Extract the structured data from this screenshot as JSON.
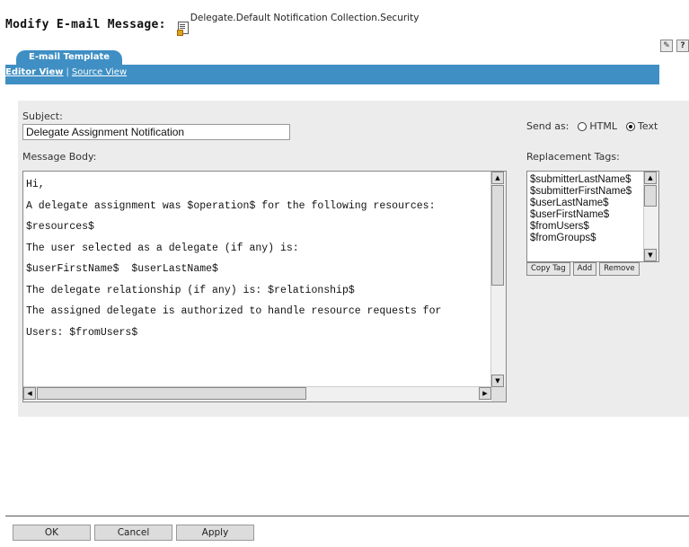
{
  "page": {
    "title": "Modify E-mail Message:",
    "object_name": "Delegate.Default Notification Collection.Security",
    "icons": [
      "document-icon",
      "edit-icon",
      "help-icon"
    ]
  },
  "tabs": [
    {
      "label": "E-mail Template",
      "active": true
    }
  ],
  "views": {
    "editor": "Editor View",
    "separator": "|",
    "source": "Source View"
  },
  "form": {
    "subject_label": "Subject:",
    "subject_value": "Delegate Assignment Notification",
    "body_label": "Message Body:",
    "body_lines": [
      "Hi,",
      "A delegate assignment was $operation$ for the following resources:",
      "$resources$",
      "The user selected as a delegate (if any) is:",
      "$userFirstName$  $userLastName$",
      "The delegate relationship (if any) is: $relationship$",
      "The assigned delegate is authorized to handle resource requests for",
      "Users: $fromUsers$"
    ],
    "send_as_label": "Send as:",
    "send_as_options": [
      {
        "label": "HTML",
        "selected": false
      },
      {
        "label": "Text",
        "selected": true
      }
    ],
    "replacement_tags_label": "Replacement Tags:",
    "replacement_tags": [
      "$submitterLastName$",
      "$submitterFirstName$",
      "$userLastName$",
      "$userFirstName$",
      "$fromUsers$",
      "$fromGroups$"
    ],
    "tag_buttons": [
      "Copy Tag",
      "Add",
      "Remove"
    ]
  },
  "footer": {
    "buttons": [
      "OK",
      "Cancel",
      "Apply"
    ]
  }
}
